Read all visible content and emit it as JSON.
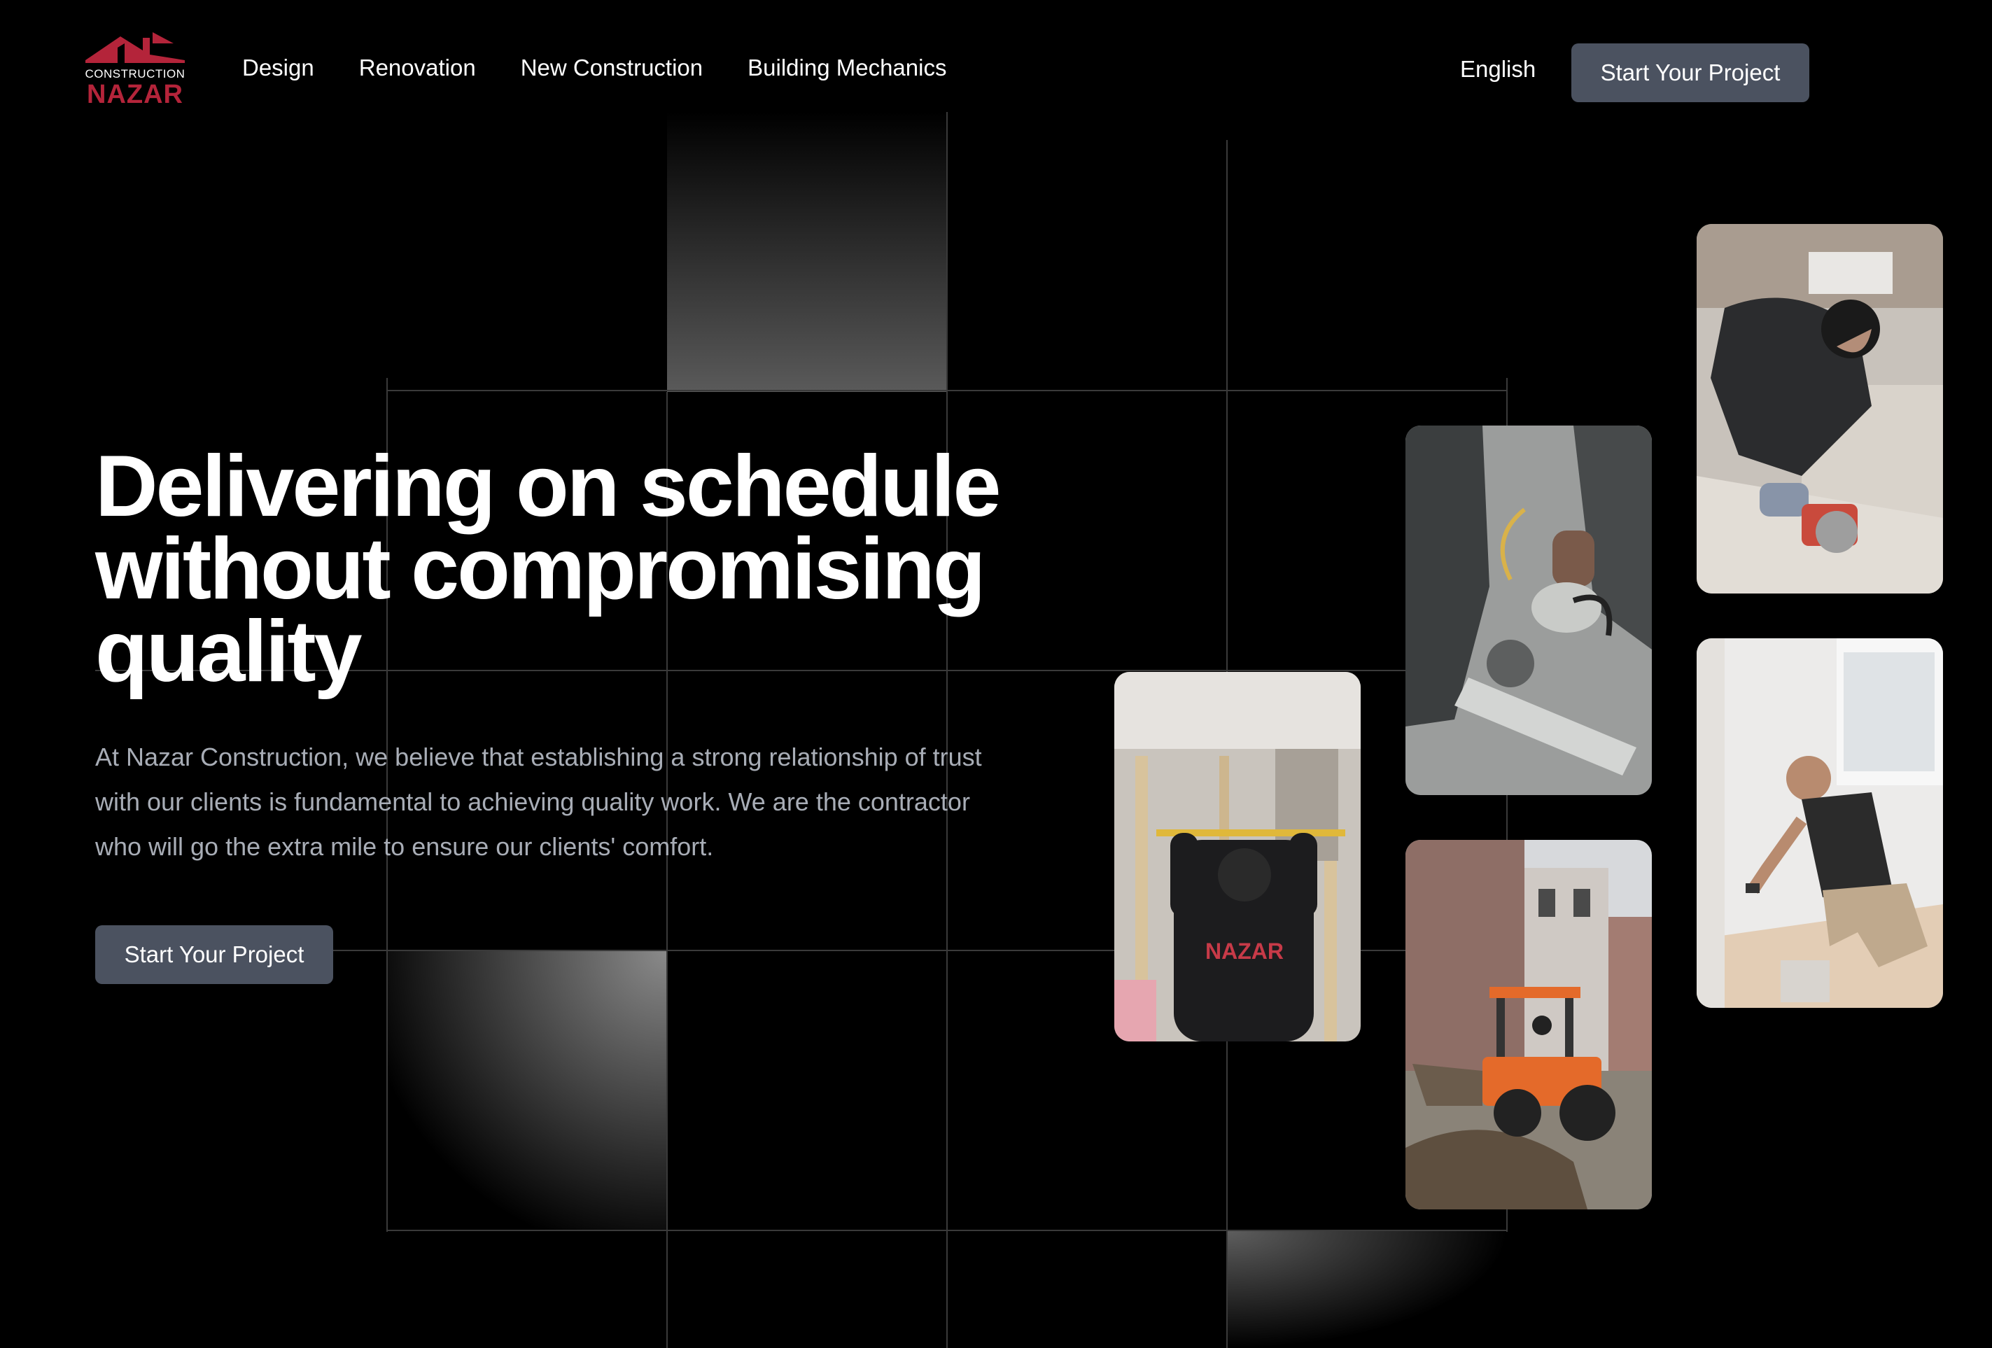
{
  "header": {
    "logo_top": "CONSTRUCTION",
    "logo_main": "NAZAR",
    "nav": [
      "Design",
      "Renovation",
      "New Construction",
      "Building Mechanics"
    ],
    "language": "English",
    "cta_label": "Start Your Project"
  },
  "hero": {
    "title_line1": "Delivering on schedule",
    "title_line2": "without compromising",
    "title_line3": "quality",
    "description": "At Nazar Construction, we believe that establishing a strong relationship of trust with our clients is fundamental to achieving quality work. We are the contractor who will go the extra mile to ensure our clients' comfort.",
    "cta_label": "Start Your Project"
  },
  "photos": [
    {
      "name": "photo-worker-leveling",
      "icon": "worker-with-level"
    },
    {
      "name": "photo-cutting-tool",
      "icon": "grinder-on-metal"
    },
    {
      "name": "photo-excavator",
      "icon": "orange-loader"
    },
    {
      "name": "photo-sawing-floor",
      "icon": "circular-saw"
    },
    {
      "name": "photo-painting-wall",
      "icon": "painter-kneeling"
    }
  ],
  "colors": {
    "brand_red": "#b4243a",
    "button_bg": "#4b5260",
    "background": "#000000",
    "body_text": "#a8adb6"
  }
}
